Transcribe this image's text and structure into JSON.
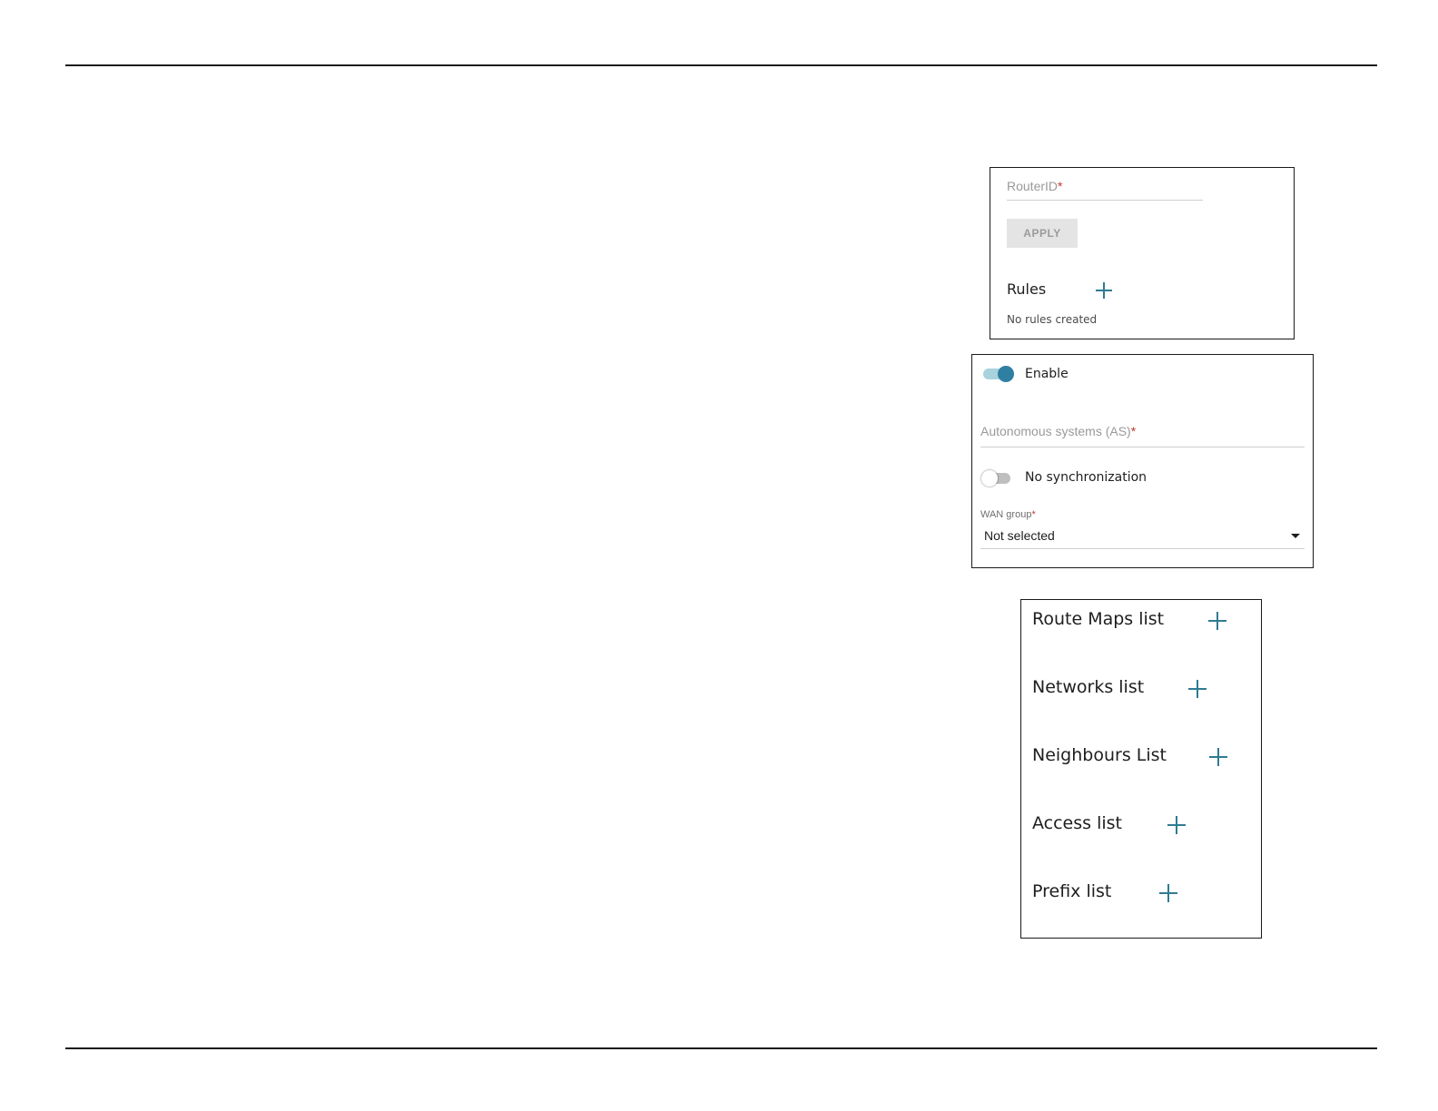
{
  "router_panel": {
    "router_id_label": "RouterID",
    "required_mark": "*",
    "apply_label": "APPLY",
    "rules_title": "Rules",
    "rules_empty": "No rules created"
  },
  "bgp_panel": {
    "enable_label": "Enable",
    "enable_on": true,
    "as_label": "Autonomous systems (AS)",
    "required_mark": "*",
    "sync_label": "No synchronization",
    "sync_on": false,
    "wan_group_label": "WAN group",
    "wan_group_value": "Not selected"
  },
  "lists_panel": {
    "items": [
      {
        "label": "Route Maps list"
      },
      {
        "label": "Networks list"
      },
      {
        "label": "Neighbours List"
      },
      {
        "label": "Access list"
      },
      {
        "label": "Prefix list"
      }
    ]
  },
  "colors": {
    "accent": "#2f7b93",
    "toggle_on_knob": "#2f7fa3",
    "toggle_on_track": "#a8d2dc",
    "required": "#c0392b",
    "button_disabled_bg": "#e4e4e4"
  }
}
